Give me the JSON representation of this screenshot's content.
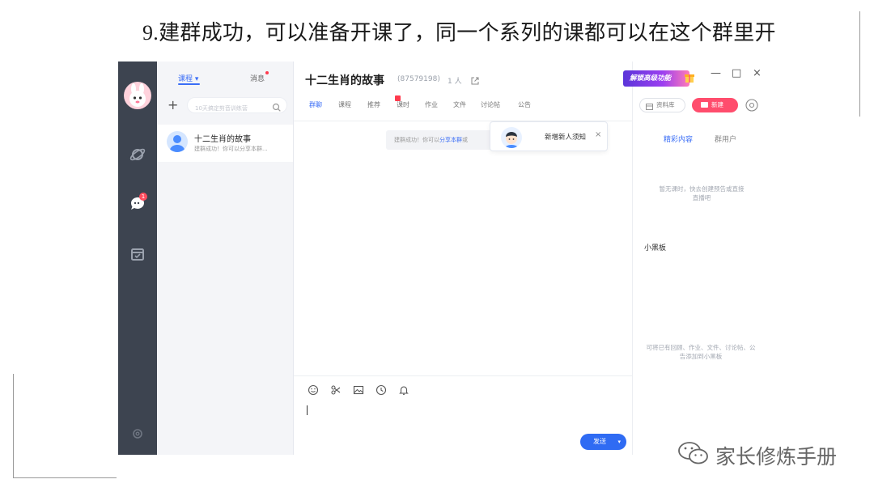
{
  "caption": {
    "number": "9.",
    "text": "建群成功，可以准备开课了，同一个系列的课都可以在这个群里开"
  },
  "sidebar": {
    "badge_count": "1",
    "icons": [
      "avatar-bunny",
      "planet-icon",
      "chat-icon",
      "calendar-check-icon",
      "settings-icon"
    ]
  },
  "list_panel": {
    "tab_course": "课程 ▾",
    "tab_messages": "消息",
    "search_placeholder": "10天搞定剪音训练营",
    "conversation": {
      "title": "十二生肖的故事",
      "preview": "建群成功！你可以分享本群..."
    }
  },
  "chat": {
    "title": "十二生肖的故事",
    "group_id": "(87579198)",
    "member_count": "1 人",
    "tabs": [
      "群聊",
      "课程",
      "推荐",
      "课时",
      "作业",
      "文件",
      "讨论帖",
      "公告"
    ],
    "system_message_prefix": "建群成功！你可以",
    "system_message_link": "分享本群",
    "system_message_suffix": "或",
    "popup_text": "新增新人须知",
    "popup_close": "×",
    "send_label": "发送",
    "send_arrow": "▾"
  },
  "right_panel": {
    "promo_label": "解锁高级功能",
    "window_controls": [
      "—",
      "□",
      "×"
    ],
    "library_label": "资料库",
    "new_label": "新建",
    "tab_featured": "精彩内容",
    "tab_group_users": "群用户",
    "empty_lesson_text": "暂无课时，快去创建预告或直接直播吧",
    "blackboard_title": "小黑板",
    "blackboard_hint": "可将已有回顾、作业、文件、讨论帖、公告添加到小黑板"
  },
  "watermark": {
    "text": "家长修炼手册"
  },
  "colors": {
    "accent_blue": "#3b6ef6",
    "rail_dark": "#3d4450",
    "new_button_pink": "#ff4d6d",
    "badge_red": "#ff3b4e"
  }
}
